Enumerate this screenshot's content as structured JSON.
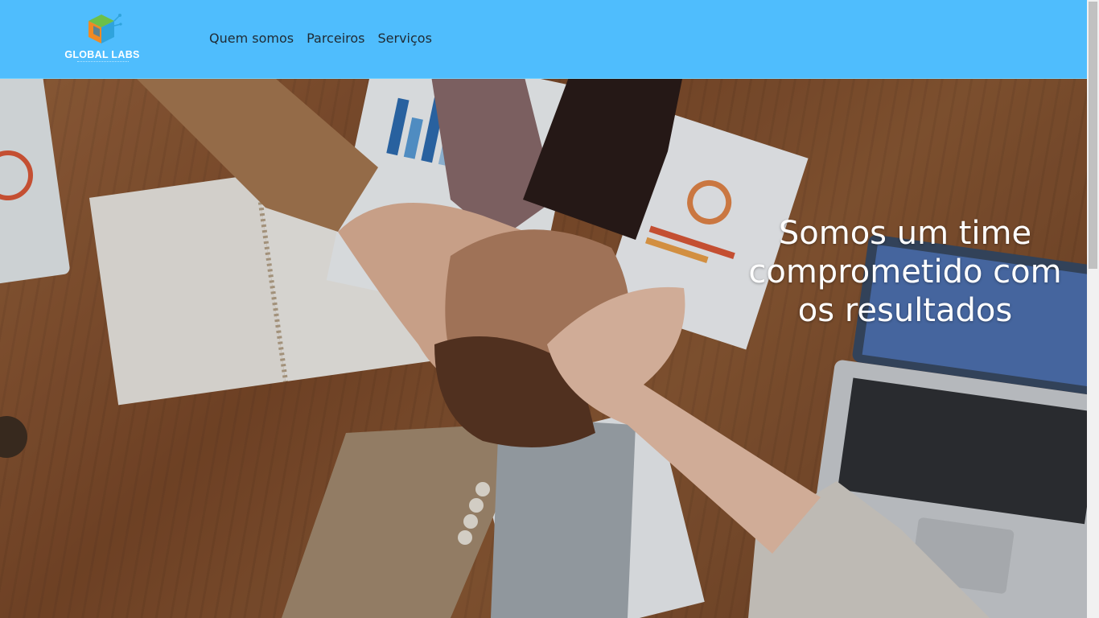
{
  "brand": {
    "name": "GLOBAL LABS",
    "logo_icon": "cube-logo-icon",
    "colors": {
      "cube_blue": "#2fa3dc",
      "cube_orange": "#f08a24",
      "cube_green": "#6cc04a"
    }
  },
  "nav": {
    "background": "#4fbdfd",
    "items": [
      {
        "label": "Quem somos"
      },
      {
        "label": "Parceiros"
      },
      {
        "label": "Serviços"
      }
    ]
  },
  "hero": {
    "title": "Somos um time comprometido com os resultados",
    "image": "team-hands-photo"
  }
}
